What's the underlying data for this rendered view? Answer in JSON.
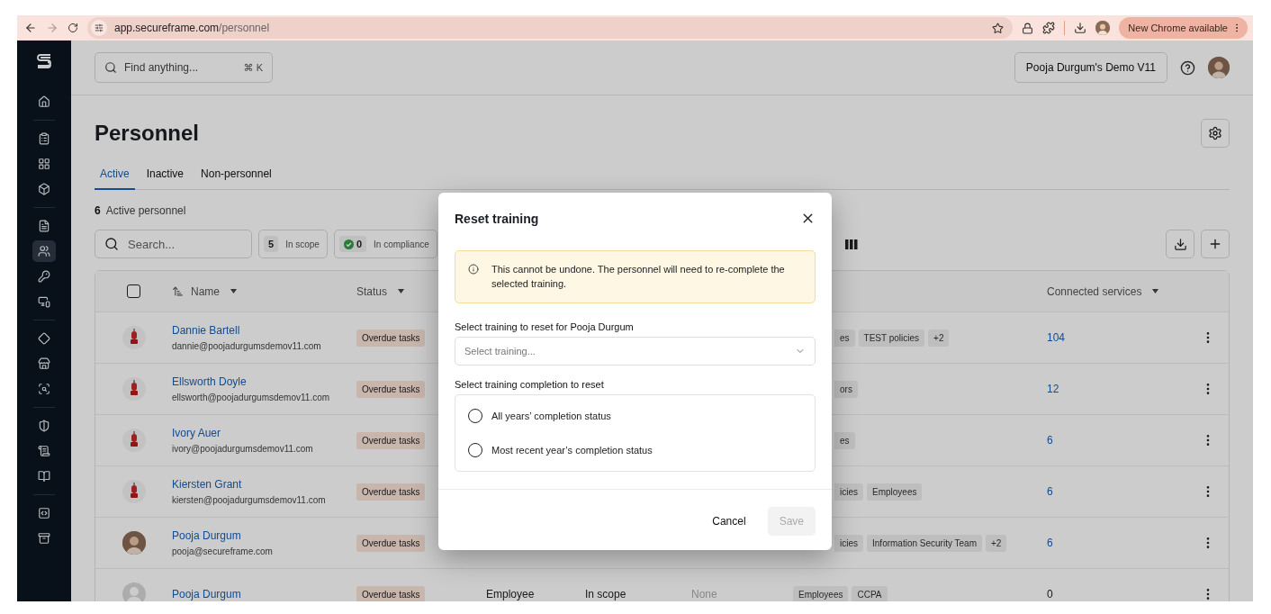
{
  "browser": {
    "url_host": "app.secureframe.com",
    "url_path": "/personnel",
    "update_button": "New Chrome available"
  },
  "sidebar": {
    "groups": [
      {
        "items": [
          {
            "selected": false
          }
        ]
      },
      {
        "items": [
          {
            "selected": false
          },
          {
            "selected": false
          },
          {
            "selected": false
          }
        ]
      },
      {
        "items": [
          {
            "selected": false
          },
          {
            "selected": true
          },
          {
            "selected": false
          },
          {
            "selected": false
          }
        ]
      },
      {
        "items": [
          {
            "selected": false
          },
          {
            "selected": false
          },
          {
            "selected": false
          }
        ]
      },
      {
        "items": [
          {
            "selected": false
          },
          {
            "selected": false
          },
          {
            "selected": false
          }
        ]
      },
      {
        "items": [
          {
            "selected": false
          },
          {
            "selected": false
          }
        ]
      }
    ]
  },
  "topbar": {
    "search": {
      "placeholder": "Find anything...",
      "shortcut": "⌘ K"
    },
    "workspace_button": "Pooja Durgum's Demo V11"
  },
  "page": {
    "title": "Personnel",
    "tabs": [
      {
        "label": "Active",
        "selected": true
      },
      {
        "label": "Inactive",
        "selected": false
      },
      {
        "label": "Non-personnel",
        "selected": false
      }
    ],
    "count": "6",
    "count_label": "Active personnel"
  },
  "toolbar": {
    "search": {
      "placeholder": "Search..."
    },
    "filters": [
      {
        "kind": "plain",
        "count": "5",
        "label": "In scope"
      },
      {
        "kind": "check",
        "count": "0",
        "label": "In compliance"
      }
    ]
  },
  "table": {
    "select_all_checked": false,
    "columns": [
      {
        "label": "Name",
        "kind": "sortable"
      },
      {
        "label": "Status",
        "kind": "plain"
      },
      {
        "label": "Connected services",
        "kind": "plain"
      }
    ],
    "rows": [
      {
        "avatar": {
          "kind": "figure"
        },
        "name": "Dannie Bartell",
        "email": "dannie@poojadurgumsdemov11.com",
        "status": "Overdue tasks",
        "tags": [
          "es",
          "TEST policies",
          "+2"
        ],
        "first_tag_partial": true,
        "services": "104",
        "services_linked": true
      },
      {
        "avatar": {
          "kind": "figure"
        },
        "name": "Ellsworth Doyle",
        "email": "ellsworth@poojadurgumsdemov11.com",
        "status": "Overdue tasks",
        "tags": [
          "ors"
        ],
        "first_tag_partial": true,
        "services": "12",
        "services_linked": true
      },
      {
        "avatar": {
          "kind": "figure"
        },
        "name": "Ivory Auer",
        "email": "ivory@poojadurgumsdemov11.com",
        "status": "Overdue tasks",
        "tags": [
          "es"
        ],
        "first_tag_partial": true,
        "services": "6",
        "services_linked": true
      },
      {
        "avatar": {
          "kind": "figure"
        },
        "name": "Kiersten Grant",
        "email": "kiersten@poojadurgumsdemov11.com",
        "status": "Overdue tasks",
        "tags": [
          "icies",
          "Employees"
        ],
        "first_tag_partial": true,
        "services": "6",
        "services_linked": true
      },
      {
        "avatar": {
          "kind": "photo"
        },
        "name": "Pooja Durgum",
        "email": "pooja@secureframe.com",
        "status": "Overdue tasks",
        "tags": [
          "icies",
          "Information Security Team",
          "+2"
        ],
        "first_tag_partial": true,
        "services": "6",
        "services_linked": true
      },
      {
        "avatar": {
          "kind": "placeholder"
        },
        "name": "Pooja Durgum",
        "status": "Overdue tasks",
        "column_3": "Employee",
        "column_4": "In scope",
        "column_5": "None",
        "tags": [
          "Employees",
          "CCPA"
        ],
        "services": "0",
        "services_linked": false
      }
    ]
  },
  "dialog": {
    "title": "Reset training",
    "warning": "This cannot be undone. The personnel will need to re-complete the selected training.",
    "training_label": "Select training to reset for Pooja Durgum",
    "training_select": {
      "placeholder": "Select training..."
    },
    "completion_label": "Select training completion to reset",
    "options": [
      {
        "label": "All years’ completion status",
        "selected": false
      },
      {
        "label": "Most recent year’s completion status",
        "selected": false
      }
    ],
    "cancel": "Cancel",
    "save": {
      "label": "Save",
      "disabled": true
    }
  }
}
